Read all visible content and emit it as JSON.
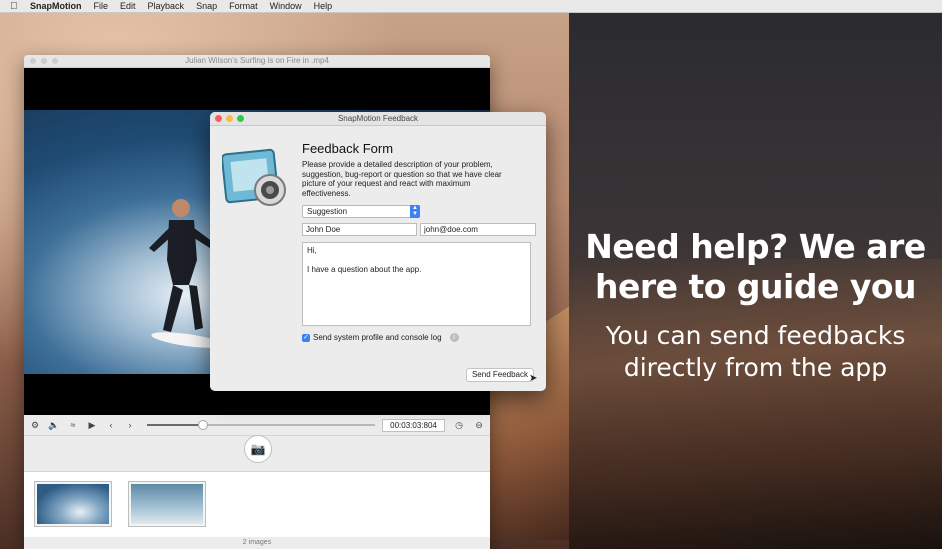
{
  "menubar": {
    "app_name": "SnapMotion",
    "items": [
      "File",
      "Edit",
      "Playback",
      "Snap",
      "Format",
      "Window",
      "Help"
    ]
  },
  "main_window": {
    "title": "Julian Wilson's Surfing is on Fire in .mp4",
    "timecode": "00:03:03:804",
    "playback_progress": 0.24,
    "status": "2 images"
  },
  "dialog": {
    "title": "SnapMotion Feedback",
    "heading": "Feedback Form",
    "description": "Please provide a detailed description of your problem, suggestion, bug-report or question so that we have clear picture of your request and react with maximum effectiveness.",
    "category": "Suggestion",
    "name_value": "John Doe",
    "email_value": "john@doe.com",
    "message": "Hi,\n\nI have a question about the app.",
    "checkbox_label": "Send system profile and console log",
    "checkbox_checked": true,
    "send_label": "Send Feedback"
  },
  "promo": {
    "headline": "Need help? We are here to guide you",
    "subline": "You can send  feedbacks directly from the app"
  },
  "colors": {
    "accent": "#3b82f6",
    "close": "#fc605b",
    "minimize": "#fdbc40",
    "zoom": "#34c84a"
  }
}
